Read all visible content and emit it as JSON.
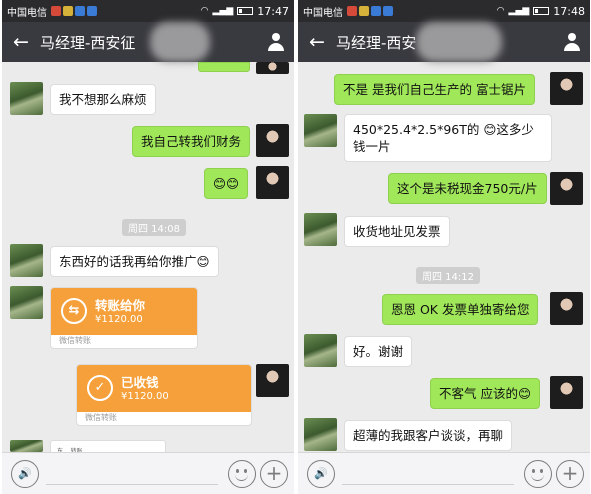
{
  "status": {
    "carrier": "中国电信",
    "time_left": "17:47",
    "time_right": "17:48"
  },
  "chat": {
    "title_left": "马经理-西安征",
    "title_right": "马经理-西安"
  },
  "left_panel": {
    "msg1": "我不想那么麻烦",
    "msg2": "我自己转我们财务",
    "msg3": "😊😊",
    "timestamp": "周四 14:08",
    "msg4": "东西好的话我再给你推广😊",
    "transfer1": {
      "label": "转账给你",
      "amount": "¥1120.00",
      "footer": "微信转账"
    },
    "transfer2": {
      "label": "已收钱",
      "amount": "¥1120.00",
      "footer": "微信转账"
    },
    "partial_text": "东... 转账..."
  },
  "right_panel": {
    "msg1": "不是 是我们自己生产的 富士锯片",
    "msg2": "450*25.4*2.5*96T的 😊这多少钱一片",
    "msg3": "这个是未税现金750元/片",
    "msg4": "收货地址见发票",
    "timestamp": "周四 14:12",
    "msg5": "恩恩 OK 发票单独寄给您",
    "msg6": "好。谢谢",
    "msg7": "不客气 应该的😊",
    "msg8": "超薄的我跟客户谈谈，再聊"
  },
  "icons": {
    "back": "←",
    "voice": "🔊",
    "plus": "+",
    "transfer": "⇆",
    "received": "✓"
  },
  "colors": {
    "out_bubble": "#a0e75a",
    "transfer": "#f5a03a",
    "titlebar": "#393a3f",
    "statusbar": "#2b2b2d"
  }
}
